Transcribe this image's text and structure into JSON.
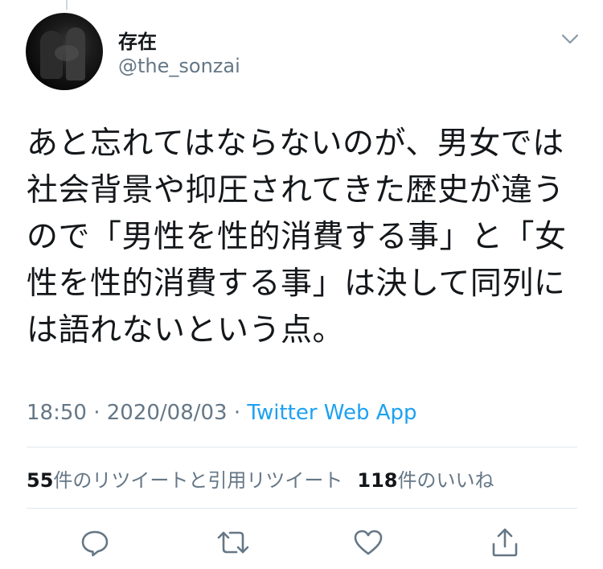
{
  "user": {
    "display_name": "存在",
    "handle": "@the_sonzai"
  },
  "tweet": {
    "text": "あと忘れてはならないのが、男女では\n社会背景や抑圧されてきた歴史が違う\nので「男性を性的消費する事」と「女\n性を性的消費する事」は決して同列に\nは語れないという点。",
    "time": "18:50",
    "separator": " · ",
    "date": "2020/08/03",
    "source": "Twitter Web App"
  },
  "stats": {
    "retweets_count": "55",
    "retweets_label": "件のリツイートと引用リツイート",
    "likes_count": "118",
    "likes_label": "件のいいね"
  },
  "icons": {
    "chevron": "chevron-down-icon",
    "reply": "reply-icon",
    "retweet": "retweet-icon",
    "like": "heart-icon",
    "share": "share-icon"
  },
  "colors": {
    "text": "#14171a",
    "secondary": "#657786",
    "link": "#1da1f2",
    "divider": "#e1e8ed"
  }
}
